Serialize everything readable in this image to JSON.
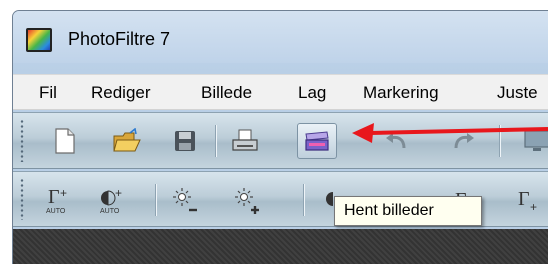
{
  "window": {
    "title": "PhotoFiltre 7",
    "app_icon": "photofiltre-app-icon"
  },
  "menu": {
    "items": [
      "Fil",
      "Rediger",
      "Billede",
      "Lag",
      "Markering",
      "Juste"
    ]
  },
  "toolbar_main": {
    "buttons": [
      {
        "icon": "new-document-icon"
      },
      {
        "icon": "open-folder-icon"
      },
      {
        "icon": "save-disk-icon"
      },
      {
        "icon": "print-icon"
      },
      {
        "icon": "scanner-acquire-icon",
        "highlighted": true
      },
      {
        "icon": "undo-icon"
      },
      {
        "icon": "redo-icon"
      },
      {
        "icon": "monitor-icon"
      }
    ]
  },
  "toolbar_adjust": {
    "buttons": [
      {
        "icon": "auto-levels-icon",
        "label": "AUTO"
      },
      {
        "icon": "auto-contrast-icon",
        "label": "AUTO"
      },
      {
        "icon": "brightness-minus-icon"
      },
      {
        "icon": "brightness-plus-icon"
      },
      {
        "icon": "contrast-icon"
      },
      {
        "icon": "gamma-icon"
      },
      {
        "icon": "gamma-plus-icon"
      }
    ]
  },
  "tooltip": {
    "text": "Hent billeder"
  },
  "annotation": {
    "arrow_color": "#e8171c"
  }
}
